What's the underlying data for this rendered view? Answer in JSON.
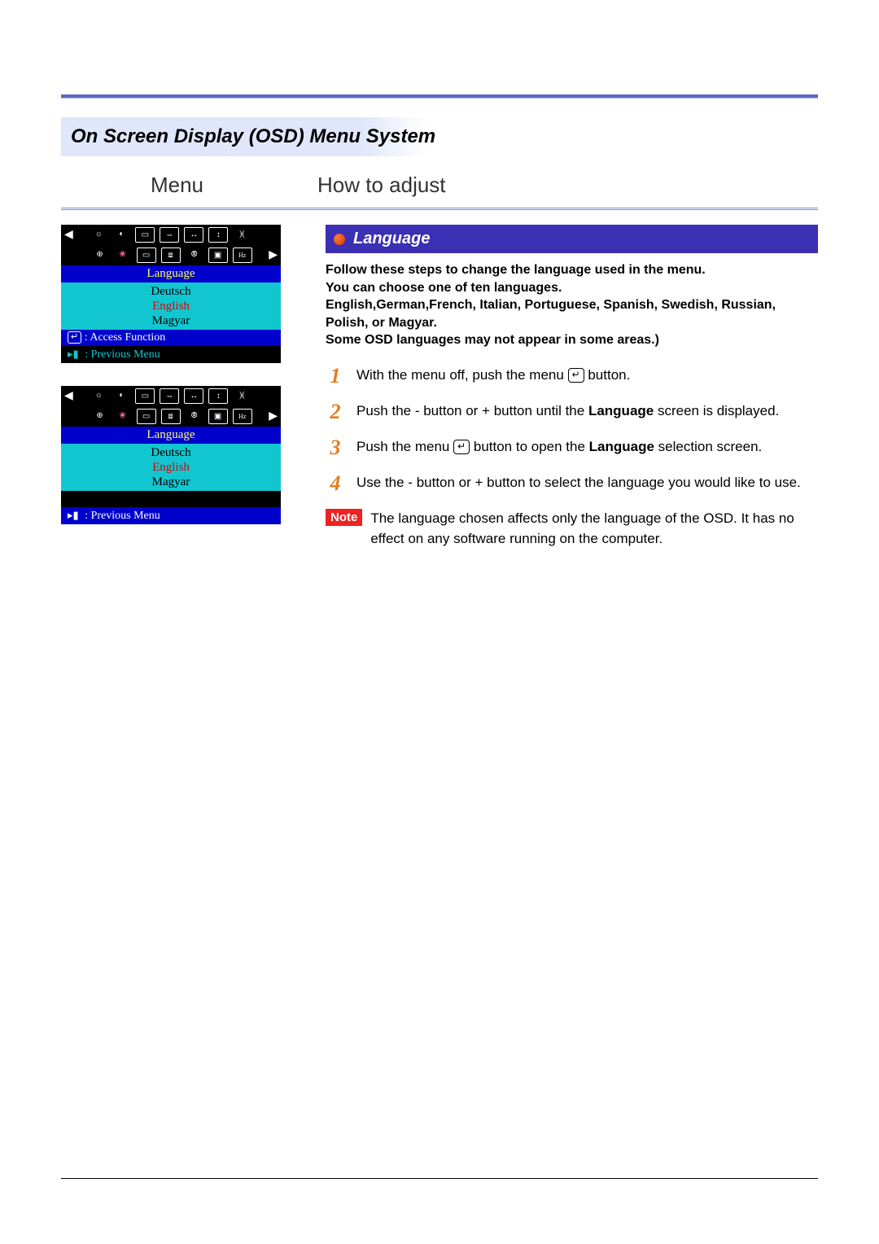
{
  "page_title": "On Screen Display (OSD) Menu System",
  "columns": {
    "menu": "Menu",
    "howto": "How to adjust"
  },
  "osd": {
    "label": "Language",
    "items": [
      "Deutsch",
      "English",
      "Magyar"
    ],
    "selected_index": 1,
    "access_function": "Access Function",
    "previous_menu": "Previous Menu"
  },
  "section": {
    "title": "Language",
    "intro_line1": "Follow these steps to change the language used in the menu.",
    "intro_line2": "You can choose one of ten languages.",
    "intro_line3": "English,German,French, Italian, Portuguese, Spanish,  Swedish, Russian, Polish, or Magyar.",
    "intro_line4": "Some OSD languages may not appear in some areas.)"
  },
  "steps": {
    "s1a": "With the menu off, push the menu ",
    "s1b": " button.",
    "s2a": "Push the  - button or  + button until the ",
    "s2_bold": "Language",
    "s2b": " screen is displayed.",
    "s3a": "Push the menu ",
    "s3b": " button to open the ",
    "s3_bold": "Language",
    "s3c": " selection screen.",
    "s4": "Use the - button or + button to select the language you would like to use."
  },
  "note": {
    "badge": "Note",
    "text": "The language chosen affects only the language of the OSD. It has no effect on any software running on the computer."
  },
  "step_numbers": [
    "1",
    "2",
    "3",
    "4"
  ]
}
